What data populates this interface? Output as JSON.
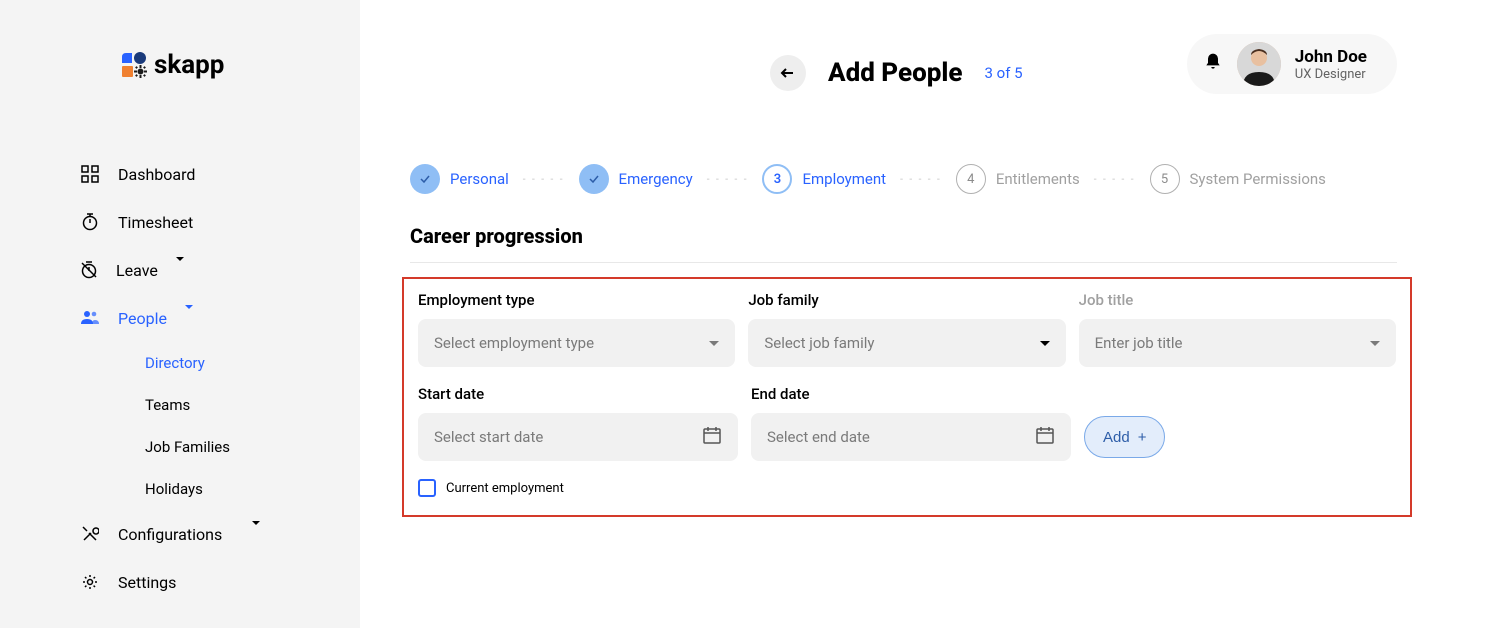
{
  "brand": {
    "name": "skapp"
  },
  "user": {
    "name": "John Doe",
    "role": "UX Designer"
  },
  "sidebar": {
    "items": [
      {
        "label": "Dashboard"
      },
      {
        "label": "Timesheet"
      },
      {
        "label": "Leave"
      },
      {
        "label": "People"
      },
      {
        "label": "Configurations"
      },
      {
        "label": "Settings"
      }
    ],
    "people_sub": [
      {
        "label": "Directory"
      },
      {
        "label": "Teams"
      },
      {
        "label": "Job Families"
      },
      {
        "label": "Holidays"
      }
    ]
  },
  "page": {
    "title": "Add People",
    "step_text": "3 of 5"
  },
  "stepper": {
    "steps": [
      {
        "num": "✓",
        "label": "Personal"
      },
      {
        "num": "✓",
        "label": "Emergency"
      },
      {
        "num": "3",
        "label": "Employment"
      },
      {
        "num": "4",
        "label": "Entitlements"
      },
      {
        "num": "5",
        "label": "System Permissions"
      }
    ]
  },
  "section": {
    "title": "Career progression"
  },
  "form": {
    "employment_type": {
      "label": "Employment type",
      "placeholder": "Select employment type"
    },
    "job_family": {
      "label": "Job family",
      "placeholder": "Select job family"
    },
    "job_title": {
      "label": "Job title",
      "placeholder": "Enter job title"
    },
    "start_date": {
      "label": "Start date",
      "placeholder": "Select start date"
    },
    "end_date": {
      "label": "End date",
      "placeholder": "Select end date"
    },
    "add_button": "Add",
    "current_employment": "Current employment"
  }
}
